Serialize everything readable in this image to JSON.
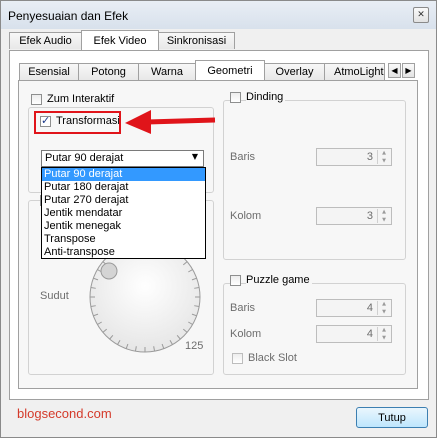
{
  "window": {
    "title": "Penyesuaian dan Efek",
    "close_glyph": "✕"
  },
  "main_tabs": [
    {
      "label": "Efek Audio"
    },
    {
      "label": "Efek Video"
    },
    {
      "label": "Sinkronisasi"
    }
  ],
  "sub_tabs": [
    {
      "label": "Esensial"
    },
    {
      "label": "Potong"
    },
    {
      "label": "Warna"
    },
    {
      "label": "Geometri"
    },
    {
      "label": "Overlay"
    },
    {
      "label": "AtmoLight"
    }
  ],
  "active_main_tab": "Efek Video",
  "active_sub_tab": "Geometri",
  "geometry": {
    "interactive_zoom": {
      "label": "Zum Interaktif",
      "checked": false
    },
    "transform": {
      "label": "Transformasi",
      "checked": true
    },
    "transform_select": {
      "value": "Putar 90 derajat",
      "options": [
        "Putar 90 derajat",
        "Putar 180 derajat",
        "Putar 270 derajat",
        "Jentik mendatar",
        "Jentik menegak",
        "Transpose",
        "Anti-transpose"
      ]
    },
    "rotate": {
      "angle_label": "Sudut",
      "angle_value": "125"
    }
  },
  "wall": {
    "label": "Dinding",
    "checked": false,
    "rows_label": "Baris",
    "rows_value": "3",
    "cols_label": "Kolom",
    "cols_value": "3"
  },
  "puzzle": {
    "label": "Puzzle game",
    "checked": false,
    "rows_label": "Baris",
    "rows_value": "4",
    "cols_label": "Kolom",
    "cols_value": "4",
    "black_slot_label": "Black Slot"
  },
  "footer": {
    "close_label": "Tutup",
    "watermark": "blogsecond.com"
  },
  "colors": {
    "accent_red": "#e0141a",
    "selection_blue": "#3399ff",
    "watermark": "#d43a2a"
  }
}
